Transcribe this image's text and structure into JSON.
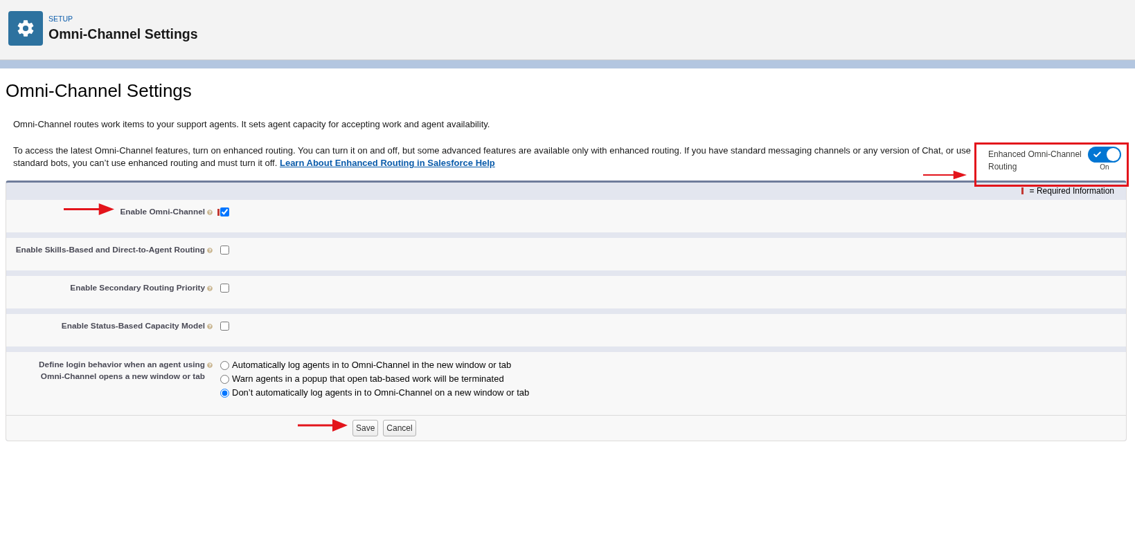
{
  "header": {
    "breadcrumb": "SETUP",
    "title": "Omni-Channel Settings"
  },
  "page_title": "Omni-Channel Settings",
  "intro": "Omni-Channel routes work items to your support agents. It sets agent capacity for accepting work and agent availability.",
  "routing_notice": {
    "text": "To access the latest Omni-Channel features, turn on enhanced routing. You can turn it on and off, but some advanced features are available only with enhanced routing. If you have standard messaging channels or any version of Chat, or use standard bots, you can’t use enhanced routing and must turn it off.",
    "link": "Learn About Enhanced Routing in Salesforce Help"
  },
  "enhanced_routing": {
    "label": "Enhanced Omni-Channel Routing",
    "on": true,
    "status": "On"
  },
  "form": {
    "required_legend": "= Required Information",
    "fields": [
      {
        "kind": "checkbox",
        "label": "Enable Omni-Channel",
        "required": true,
        "checked": true
      },
      {
        "kind": "checkbox",
        "label": "Enable Skills-Based and Direct-to-Agent Routing",
        "required": false,
        "checked": false
      },
      {
        "kind": "checkbox",
        "label": "Enable Secondary Routing Priority",
        "required": false,
        "checked": false
      },
      {
        "kind": "checkbox",
        "label": "Enable Status-Based Capacity Model",
        "required": false,
        "checked": false
      },
      {
        "kind": "radio",
        "label": "Define login behavior when an agent using Omni-Channel opens a new window or tab",
        "required": false,
        "options": [
          {
            "label": "Automatically log agents in to Omni-Channel in the new window or tab",
            "selected": false
          },
          {
            "label": "Warn agents in a popup that open tab-based work will be terminated",
            "selected": false
          },
          {
            "label": "Don’t automatically log agents in to Omni-Channel on a new window or tab",
            "selected": true
          }
        ]
      }
    ],
    "buttons": [
      "Save",
      "Cancel"
    ]
  }
}
